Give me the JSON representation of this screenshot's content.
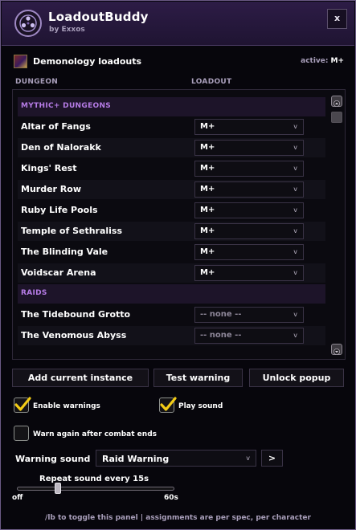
{
  "app": {
    "title": "LoadoutBuddy",
    "author": "by Exxos",
    "close_label": "x",
    "logo_icon": "addon-logo-icon"
  },
  "spec": {
    "name": "Demonology loadouts",
    "icon": "demonology-spec-icon",
    "active_label": "active:",
    "active_value": "M+"
  },
  "columns": {
    "dungeon": "DUNGEON",
    "loadout": "LOADOUT"
  },
  "sections": [
    {
      "label": "MYTHIC+ DUNGEONS",
      "rows": [
        {
          "name": "Altar of Fangs",
          "loadout": "M+"
        },
        {
          "name": "Den of Nalorakk",
          "loadout": "M+"
        },
        {
          "name": "Kings' Rest",
          "loadout": "M+"
        },
        {
          "name": "Murder Row",
          "loadout": "M+"
        },
        {
          "name": "Ruby Life Pools",
          "loadout": "M+"
        },
        {
          "name": "Temple of Sethraliss",
          "loadout": "M+"
        },
        {
          "name": "The Blinding Vale",
          "loadout": "M+"
        },
        {
          "name": "Voidscar Arena",
          "loadout": "M+"
        }
      ]
    },
    {
      "label": "RAIDS",
      "rows": [
        {
          "name": "The Tidebound Grotto",
          "loadout": "-- none --"
        },
        {
          "name": "The Venomous Abyss",
          "loadout": "-- none --"
        }
      ]
    }
  ],
  "dropdown_icon": "v",
  "buttons": {
    "add_instance": "Add current instance",
    "test_warning": "Test warning",
    "unlock_popup": "Unlock popup"
  },
  "options": {
    "enable_warnings": {
      "label": "Enable warnings",
      "checked": true
    },
    "play_sound": {
      "label": "Play sound",
      "checked": true
    },
    "warn_again": {
      "label": "Warn again after combat ends",
      "checked": false
    }
  },
  "warning_sound": {
    "label": "Warning sound",
    "value": "Raid Warning",
    "play_label": ">"
  },
  "repeat_slider": {
    "title": "Repeat sound every 15s",
    "min_label": "off",
    "max_label": "60s",
    "value": 15,
    "min": 0,
    "max": 60
  },
  "footer": "/lb to toggle this panel  |  assignments are per spec, per character",
  "colors": {
    "accent_purple": "#b67ce6",
    "check_yellow": "#f2cb16",
    "title_bar": "#2d1c46"
  }
}
